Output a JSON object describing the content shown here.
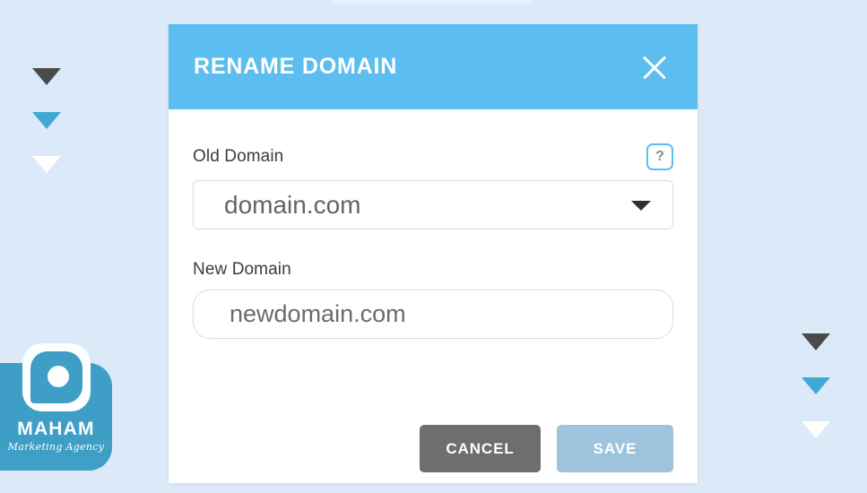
{
  "background": {
    "color": "#dce9f9",
    "decor_triangles": {
      "colors": [
        "#4a4a4a",
        "#3fa9d4",
        "#ffffff"
      ],
      "names": [
        "triangle-dark",
        "triangle-blue",
        "triangle-white"
      ]
    }
  },
  "watermark": {
    "name": "MAHAM",
    "tagline": "Marketing Agency",
    "color": "#3a9cc4",
    "icon": "camera-lens-icon"
  },
  "modal": {
    "header": {
      "title": "RENAME DOMAIN",
      "background": "#5cbdf0",
      "close_icon": "close-icon"
    },
    "fields": {
      "old_domain": {
        "label": "Old Domain",
        "value": "domain.com",
        "placeholder": "domain.com",
        "help_icon": "question-mark-icon",
        "dropdown_icon": "chevron-down-icon",
        "options": [
          "domain.com"
        ]
      },
      "new_domain": {
        "label": "New Domain",
        "value": "newdomain.com",
        "placeholder": "newdomain.com"
      }
    },
    "footer": {
      "cancel_label": "CANCEL",
      "cancel_color": "#6e6e6e",
      "save_label": "SAVE",
      "save_color": "#9dc4dc"
    }
  }
}
